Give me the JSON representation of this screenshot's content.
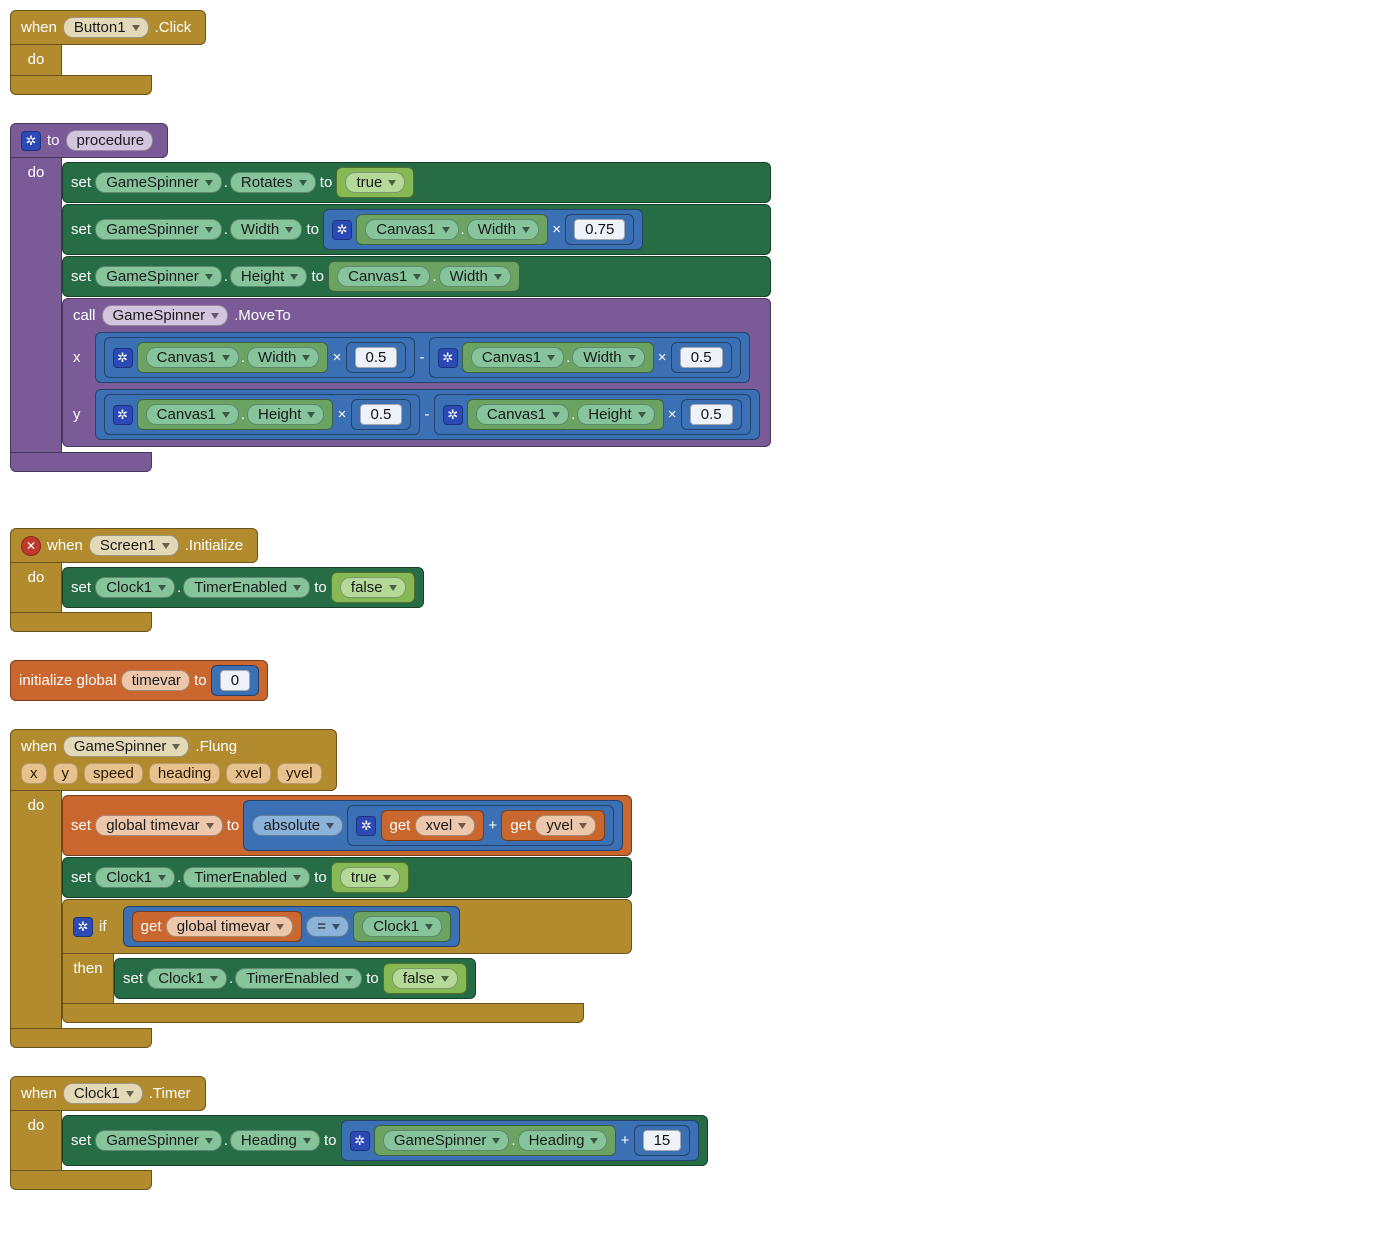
{
  "kw": {
    "when": "when",
    "do": "do",
    "to": "to",
    "set": "set",
    "call": "call",
    "if": "if",
    "then": "then",
    "get": "get",
    "initialize_global": "initialize global",
    "absolute": "absolute"
  },
  "components": {
    "Button1": "Button1",
    "Screen1": "Screen1",
    "GameSpinner": "GameSpinner",
    "Canvas1": "Canvas1",
    "Clock1": "Clock1"
  },
  "events": {
    "Click": ".Click",
    "Initialize": ".Initialize",
    "Flung": ".Flung",
    "Timer": ".Timer",
    "MoveTo": ".MoveTo"
  },
  "props": {
    "Rotates": "Rotates",
    "Width": "Width",
    "Height": "Height",
    "TimerEnabled": "TimerEnabled",
    "Heading": "Heading"
  },
  "vars": {
    "procedure": "procedure",
    "timevar": "timevar",
    "global_timevar": "global timevar"
  },
  "vals": {
    "true": "true",
    "false": "false",
    "n0": "0",
    "n075": "0.75",
    "n05a": "0.5",
    "n05b": "0.5",
    "n05c": "0.5",
    "n05d": "0.5",
    "n15": "15"
  },
  "ops": {
    "times": "×",
    "minus": "-",
    "plus": "+",
    "eq": "="
  },
  "arglabels": {
    "x": "x",
    "y": "y"
  },
  "flung_params": [
    "x",
    "y",
    "speed",
    "heading",
    "xvel",
    "yvel"
  ],
  "colors": {
    "event": "#b18b2e",
    "procedure": "#7b5a98",
    "component_set": "#266c44",
    "component_get": "#6ba362",
    "logic_true": "#86b953",
    "math": "#3b70b4",
    "variable": "#c9672e"
  }
}
